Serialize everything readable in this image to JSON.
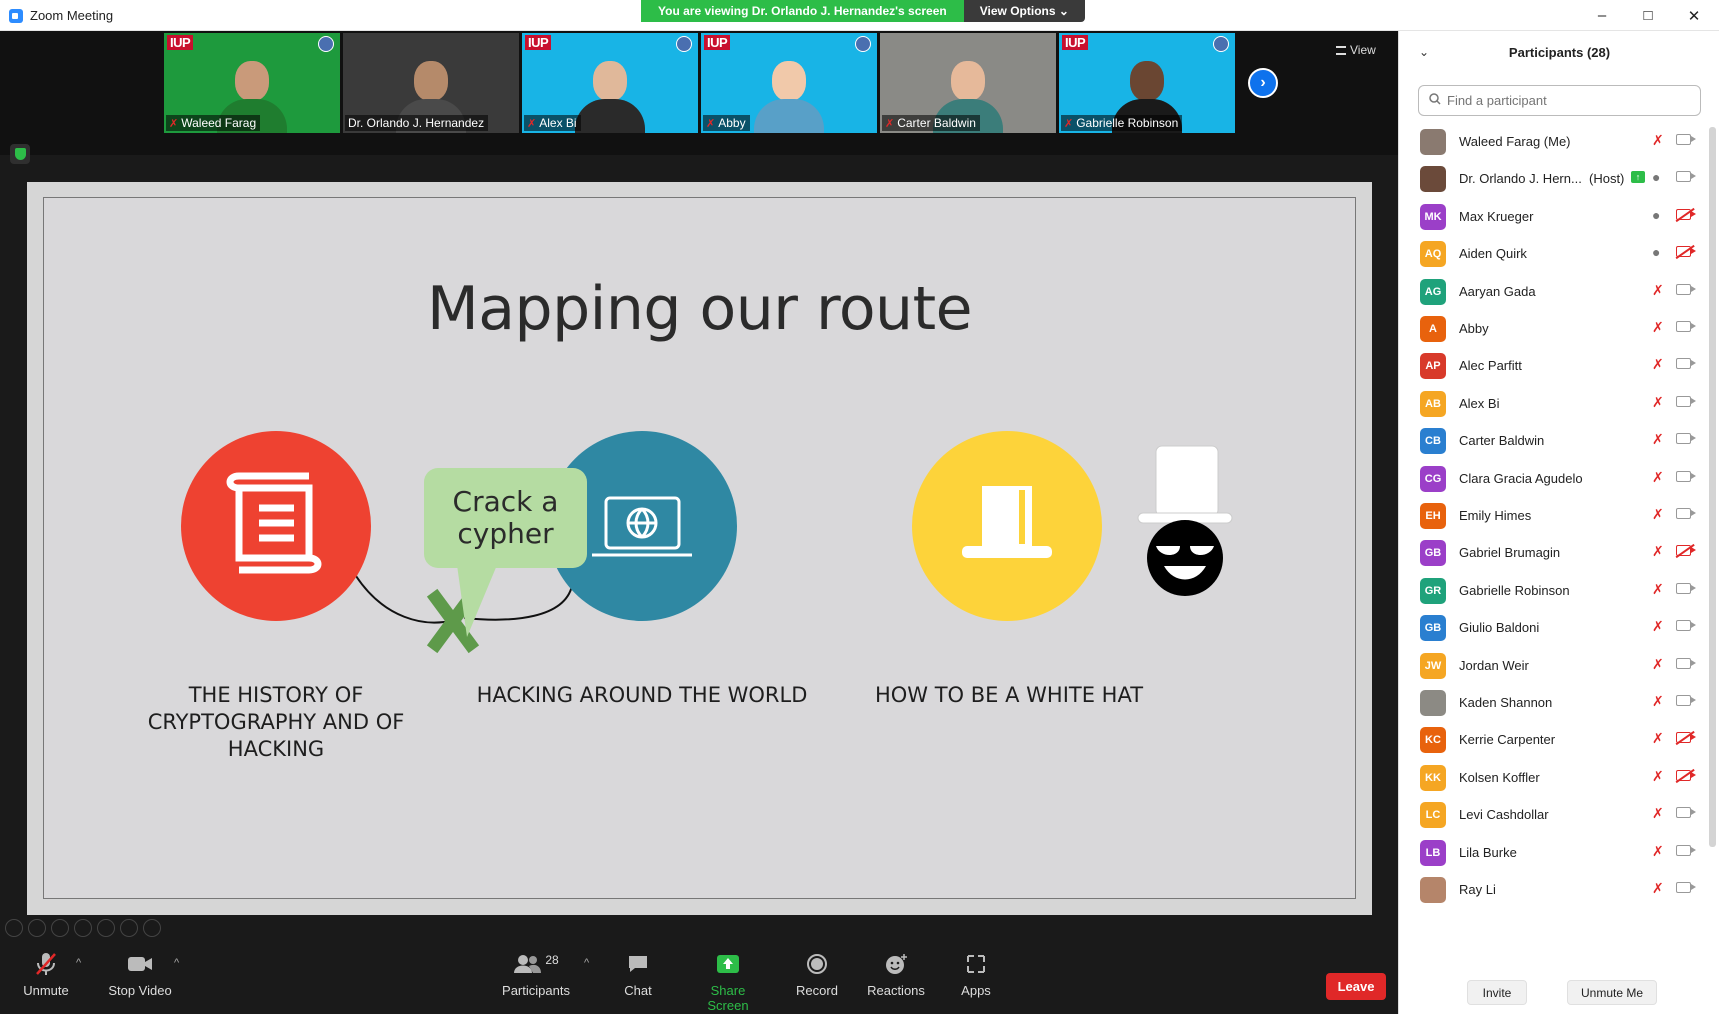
{
  "window": {
    "title": "Zoom Meeting"
  },
  "banner": {
    "viewing": "You are viewing Dr. Orlando J. Hernandez's screen",
    "view_options": "View Options ⌄"
  },
  "thumbnails": [
    {
      "name": "Waleed Farag",
      "bg": "#1e9a3d",
      "skin": "#c99a7a",
      "shirt": "#1f7d2f"
    },
    {
      "name": "Dr. Orlando J. Hernandez",
      "bg": "#3a3a3a",
      "skin": "#b58a6a",
      "shirt": "#4a4a4a"
    },
    {
      "name": "Alex Bi",
      "bg": "#18b4e6",
      "skin": "#e0b89a",
      "shirt": "#2a2a2a"
    },
    {
      "name": "Abby",
      "bg": "#18b4e6",
      "skin": "#f1c9aa",
      "shirt": "#58a0c8"
    },
    {
      "name": "Carter Baldwin",
      "bg": "#8a8a86",
      "skin": "#e6b99a",
      "shirt": "#3b7d7a"
    },
    {
      "name": "Gabrielle Robinson",
      "bg": "#18b4e6",
      "skin": "#6a4632",
      "shirt": "#1a1a1a"
    }
  ],
  "thumb_logo": "IUP",
  "view_label": "View",
  "slide": {
    "title": "Mapping our route",
    "bubble": "Crack a cypher",
    "captions": {
      "history": "THE HISTORY OF CRYPTOGRAPHY AND OF HACKING",
      "world": "HACKING AROUND THE WORLD",
      "whitehat": "HOW TO BE A WHITE HAT"
    },
    "colors": {
      "red": "#ee4231",
      "teal": "#2f88a3",
      "yellow": "#fdd33a",
      "green_x": "#5e9a4a",
      "bubble": "#b5dca2"
    }
  },
  "toolbar": {
    "unmute": "Unmute",
    "stop_video": "Stop Video",
    "participants": "Participants",
    "participant_count": "28",
    "chat": "Chat",
    "share_screen": "Share Screen",
    "record": "Record",
    "reactions": "Reactions",
    "apps": "Apps",
    "leave": "Leave"
  },
  "panel": {
    "title": "Participants (28)",
    "search_placeholder": "Find a participant",
    "host_tag": "(Host)",
    "invite": "Invite",
    "unmute_me": "Unmute Me"
  },
  "participants": [
    {
      "initials": "",
      "name": "Waleed Farag (Me)",
      "color": "#8a7a70",
      "mic": "off",
      "cam": "on"
    },
    {
      "initials": "",
      "name": "Dr. Orlando J. Hern...",
      "color": "#6b4a3a",
      "mic": "on",
      "cam": "on",
      "host": true
    },
    {
      "initials": "MK",
      "name": "Max Krueger",
      "color": "#9b3fc8",
      "mic": "on",
      "cam": "off"
    },
    {
      "initials": "AQ",
      "name": "Aiden Quirk",
      "color": "#f5a623",
      "mic": "on",
      "cam": "off"
    },
    {
      "initials": "AG",
      "name": "Aaryan Gada",
      "color": "#1fa27b",
      "mic": "off",
      "cam": "on"
    },
    {
      "initials": "A",
      "name": "Abby",
      "color": "#e8620d",
      "mic": "off",
      "cam": "on"
    },
    {
      "initials": "AP",
      "name": "Alec Parfitt",
      "color": "#d83a2a",
      "mic": "off",
      "cam": "on"
    },
    {
      "initials": "AB",
      "name": "Alex Bi",
      "color": "#f5a623",
      "mic": "off",
      "cam": "on"
    },
    {
      "initials": "CB",
      "name": "Carter Baldwin",
      "color": "#2a7fd0",
      "mic": "off",
      "cam": "on"
    },
    {
      "initials": "CG",
      "name": "Clara Gracia Agudelo",
      "color": "#9b3fc8",
      "mic": "off",
      "cam": "on"
    },
    {
      "initials": "EH",
      "name": "Emily Himes",
      "color": "#e8620d",
      "mic": "off",
      "cam": "on"
    },
    {
      "initials": "GB",
      "name": "Gabriel Brumagin",
      "color": "#9b3fc8",
      "mic": "off",
      "cam": "off"
    },
    {
      "initials": "GR",
      "name": "Gabrielle Robinson",
      "color": "#1fa27b",
      "mic": "off",
      "cam": "on"
    },
    {
      "initials": "GB",
      "name": "Giulio Baldoni",
      "color": "#2a7fd0",
      "mic": "off",
      "cam": "on"
    },
    {
      "initials": "JW",
      "name": "Jordan Weir",
      "color": "#f5a623",
      "mic": "off",
      "cam": "on"
    },
    {
      "initials": "",
      "name": "Kaden Shannon",
      "color": "#8c8a84",
      "mic": "off",
      "cam": "on"
    },
    {
      "initials": "KC",
      "name": "Kerrie Carpenter",
      "color": "#e8620d",
      "mic": "off",
      "cam": "off"
    },
    {
      "initials": "KK",
      "name": "Kolsen Koffler",
      "color": "#f5a623",
      "mic": "off",
      "cam": "off"
    },
    {
      "initials": "LC",
      "name": "Levi Cashdollar",
      "color": "#f5a623",
      "mic": "off",
      "cam": "on"
    },
    {
      "initials": "LB",
      "name": "Lila Burke",
      "color": "#9b3fc8",
      "mic": "off",
      "cam": "on"
    },
    {
      "initials": "",
      "name": "Ray Li",
      "color": "#b5856a",
      "mic": "off",
      "cam": "on"
    }
  ]
}
